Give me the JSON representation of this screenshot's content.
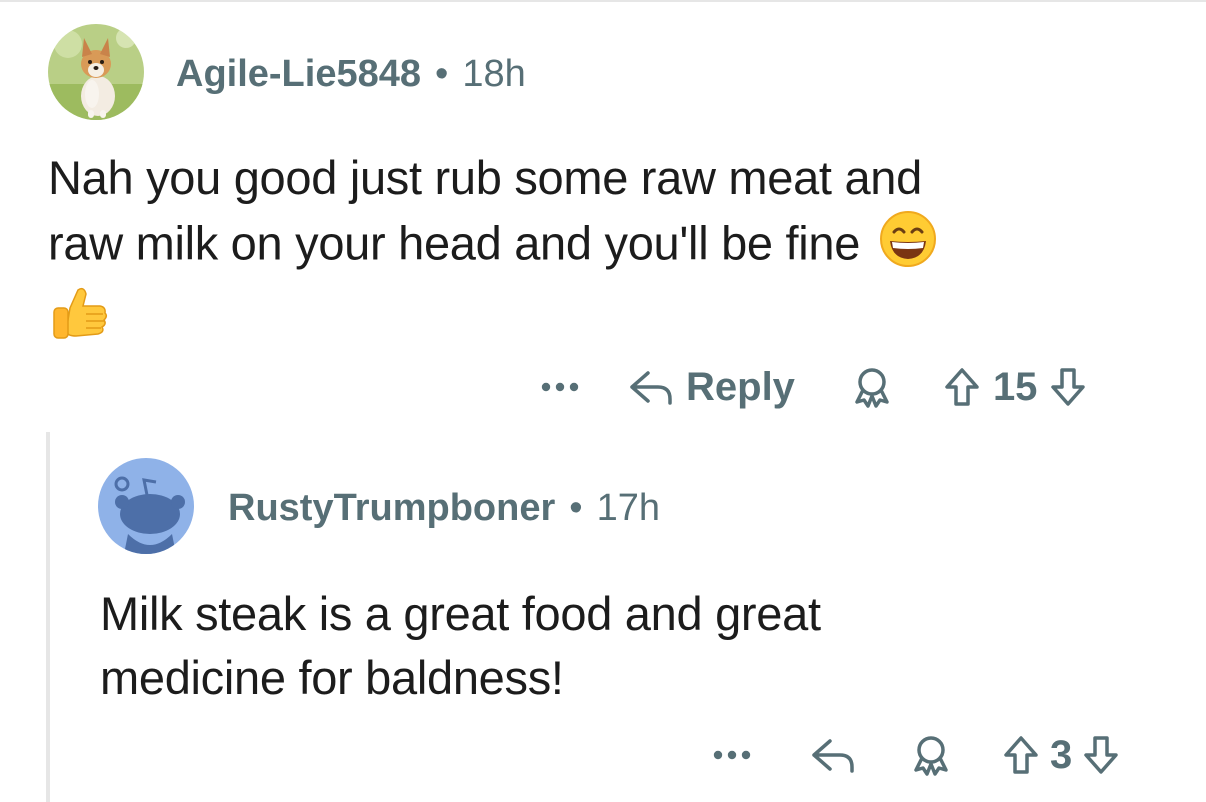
{
  "comments": [
    {
      "username": "Agile-Lie5848",
      "separator": "•",
      "time": "18h",
      "body_line1": "Nah you good just rub some raw meat and",
      "body_line2": "raw milk on your head and you'll be fine",
      "emoji_inline": "grinning-face-with-smiling-eyes",
      "emoji_next_line": "thumbs-up",
      "reply_label": "Reply",
      "score": "15",
      "more_icon": "more-dots-icon",
      "avatar": "dog-avatar"
    },
    {
      "username": "RustyTrumpboner",
      "separator": "•",
      "time": "17h",
      "body_line1": "Milk steak is a great food and great",
      "body_line2": "medicine for baldness!",
      "score": "3",
      "more_icon": "more-dots-icon",
      "avatar": "default-snoo-avatar"
    }
  ],
  "colors": {
    "meta": "#576f76",
    "text": "#1c1c1c",
    "thread_line": "#e6e6e6",
    "snoo_bg": "#8fb2e8",
    "snoo_body": "#4d6fa8"
  }
}
